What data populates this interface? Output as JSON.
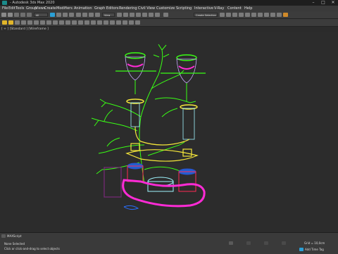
{
  "window": {
    "title": "- Autodesk 3ds Max 2020",
    "minimize": "–",
    "maximize": "□",
    "close": "✕"
  },
  "menu": [
    "File",
    "Edit",
    "Tools",
    "Group",
    "Views",
    "Create",
    "Modifiers",
    "Animation",
    "Graph Editors",
    "Rendering",
    "Civil View",
    "Customize",
    "Scripting",
    "Interactive",
    "V-Ray",
    "Content",
    "Help"
  ],
  "toolbar": {
    "selection_filter": "All",
    "view_dropdown": "View",
    "selection_set": "Create Selection Se"
  },
  "viewport": {
    "label": "[ + ] [Standard ] [Wireframe ]"
  },
  "status": {
    "selection": "None Selected",
    "prompt": "Click or click-and-drag to select objects",
    "grid": "Grid = 10,0cm",
    "add_time_tag": "Add Time Tag",
    "script_label": "MAXScript"
  },
  "colors": {
    "accent": "#2a9fd6",
    "wire_green": "#39ff14",
    "wire_magenta": "#ff2bd6",
    "wire_yellow": "#f5e63a",
    "wire_cyan": "#9ff6ff",
    "wire_red": "#ff2a55",
    "wire_blue": "#2060d0"
  }
}
